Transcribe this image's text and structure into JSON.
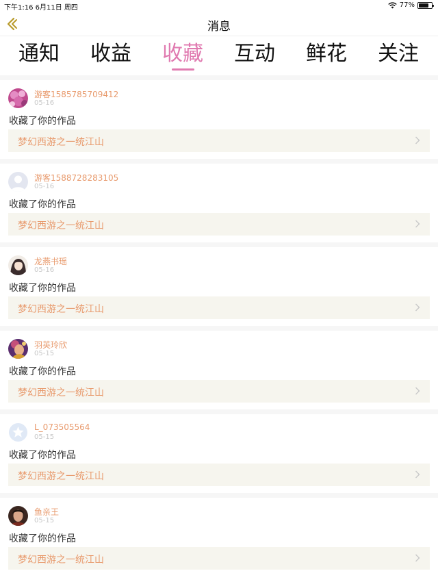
{
  "status": {
    "time_date": "下午1:16   6月11日 周四",
    "battery": "77%",
    "battery_level": 0.77
  },
  "nav": {
    "title": "消息"
  },
  "tabs": [
    {
      "label": "通知",
      "active": false
    },
    {
      "label": "收益",
      "active": false
    },
    {
      "label": "收藏",
      "active": true
    },
    {
      "label": "互动",
      "active": false
    },
    {
      "label": "鲜花",
      "active": false
    },
    {
      "label": "关注",
      "active": false
    }
  ],
  "items": [
    {
      "user": "游客1585785709412",
      "date": "05-16",
      "action": "收藏了你的作品",
      "work": "梦幻西游之一统江山",
      "avatar": "flower-photo"
    },
    {
      "user": "游客1588728283105",
      "date": "05-16",
      "action": "收藏了你的作品",
      "work": "梦幻西游之一统江山",
      "avatar": "default-person"
    },
    {
      "user": "龙燕书瑶",
      "date": "05-16",
      "action": "收藏了你的作品",
      "work": "梦幻西游之一统江山",
      "avatar": "anime-girl"
    },
    {
      "user": "羽英玲欣",
      "date": "05-15",
      "action": "收藏了你的作品",
      "work": "梦幻西游之一统江山",
      "avatar": "game-character"
    },
    {
      "user": "L_073505564",
      "date": "05-15",
      "action": "收藏了你的作品",
      "work": "梦幻西游之一统江山",
      "avatar": "star-badge"
    },
    {
      "user": "鱼亲王",
      "date": "05-15",
      "action": "收藏了你的作品",
      "work": "梦幻西游之一统江山",
      "avatar": "portrait-photo"
    }
  ],
  "colors": {
    "accent": "#e07ab0",
    "username": "#e89a6d",
    "link_bg": "#f6f5ee",
    "back_arrow": "#b89a2a"
  }
}
